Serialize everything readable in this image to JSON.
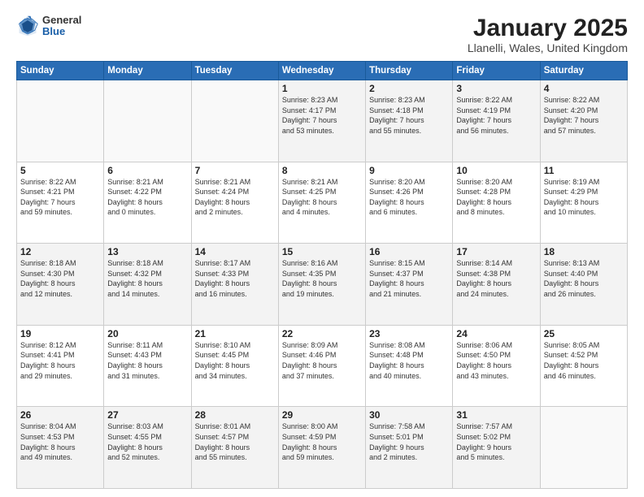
{
  "logo": {
    "general": "General",
    "blue": "Blue"
  },
  "title": {
    "month": "January 2025",
    "location": "Llanelli, Wales, United Kingdom"
  },
  "weekdays": [
    "Sunday",
    "Monday",
    "Tuesday",
    "Wednesday",
    "Thursday",
    "Friday",
    "Saturday"
  ],
  "weeks": [
    [
      {
        "day": "",
        "info": ""
      },
      {
        "day": "",
        "info": ""
      },
      {
        "day": "",
        "info": ""
      },
      {
        "day": "1",
        "info": "Sunrise: 8:23 AM\nSunset: 4:17 PM\nDaylight: 7 hours\nand 53 minutes."
      },
      {
        "day": "2",
        "info": "Sunrise: 8:23 AM\nSunset: 4:18 PM\nDaylight: 7 hours\nand 55 minutes."
      },
      {
        "day": "3",
        "info": "Sunrise: 8:22 AM\nSunset: 4:19 PM\nDaylight: 7 hours\nand 56 minutes."
      },
      {
        "day": "4",
        "info": "Sunrise: 8:22 AM\nSunset: 4:20 PM\nDaylight: 7 hours\nand 57 minutes."
      }
    ],
    [
      {
        "day": "5",
        "info": "Sunrise: 8:22 AM\nSunset: 4:21 PM\nDaylight: 7 hours\nand 59 minutes."
      },
      {
        "day": "6",
        "info": "Sunrise: 8:21 AM\nSunset: 4:22 PM\nDaylight: 8 hours\nand 0 minutes."
      },
      {
        "day": "7",
        "info": "Sunrise: 8:21 AM\nSunset: 4:24 PM\nDaylight: 8 hours\nand 2 minutes."
      },
      {
        "day": "8",
        "info": "Sunrise: 8:21 AM\nSunset: 4:25 PM\nDaylight: 8 hours\nand 4 minutes."
      },
      {
        "day": "9",
        "info": "Sunrise: 8:20 AM\nSunset: 4:26 PM\nDaylight: 8 hours\nand 6 minutes."
      },
      {
        "day": "10",
        "info": "Sunrise: 8:20 AM\nSunset: 4:28 PM\nDaylight: 8 hours\nand 8 minutes."
      },
      {
        "day": "11",
        "info": "Sunrise: 8:19 AM\nSunset: 4:29 PM\nDaylight: 8 hours\nand 10 minutes."
      }
    ],
    [
      {
        "day": "12",
        "info": "Sunrise: 8:18 AM\nSunset: 4:30 PM\nDaylight: 8 hours\nand 12 minutes."
      },
      {
        "day": "13",
        "info": "Sunrise: 8:18 AM\nSunset: 4:32 PM\nDaylight: 8 hours\nand 14 minutes."
      },
      {
        "day": "14",
        "info": "Sunrise: 8:17 AM\nSunset: 4:33 PM\nDaylight: 8 hours\nand 16 minutes."
      },
      {
        "day": "15",
        "info": "Sunrise: 8:16 AM\nSunset: 4:35 PM\nDaylight: 8 hours\nand 19 minutes."
      },
      {
        "day": "16",
        "info": "Sunrise: 8:15 AM\nSunset: 4:37 PM\nDaylight: 8 hours\nand 21 minutes."
      },
      {
        "day": "17",
        "info": "Sunrise: 8:14 AM\nSunset: 4:38 PM\nDaylight: 8 hours\nand 24 minutes."
      },
      {
        "day": "18",
        "info": "Sunrise: 8:13 AM\nSunset: 4:40 PM\nDaylight: 8 hours\nand 26 minutes."
      }
    ],
    [
      {
        "day": "19",
        "info": "Sunrise: 8:12 AM\nSunset: 4:41 PM\nDaylight: 8 hours\nand 29 minutes."
      },
      {
        "day": "20",
        "info": "Sunrise: 8:11 AM\nSunset: 4:43 PM\nDaylight: 8 hours\nand 31 minutes."
      },
      {
        "day": "21",
        "info": "Sunrise: 8:10 AM\nSunset: 4:45 PM\nDaylight: 8 hours\nand 34 minutes."
      },
      {
        "day": "22",
        "info": "Sunrise: 8:09 AM\nSunset: 4:46 PM\nDaylight: 8 hours\nand 37 minutes."
      },
      {
        "day": "23",
        "info": "Sunrise: 8:08 AM\nSunset: 4:48 PM\nDaylight: 8 hours\nand 40 minutes."
      },
      {
        "day": "24",
        "info": "Sunrise: 8:06 AM\nSunset: 4:50 PM\nDaylight: 8 hours\nand 43 minutes."
      },
      {
        "day": "25",
        "info": "Sunrise: 8:05 AM\nSunset: 4:52 PM\nDaylight: 8 hours\nand 46 minutes."
      }
    ],
    [
      {
        "day": "26",
        "info": "Sunrise: 8:04 AM\nSunset: 4:53 PM\nDaylight: 8 hours\nand 49 minutes."
      },
      {
        "day": "27",
        "info": "Sunrise: 8:03 AM\nSunset: 4:55 PM\nDaylight: 8 hours\nand 52 minutes."
      },
      {
        "day": "28",
        "info": "Sunrise: 8:01 AM\nSunset: 4:57 PM\nDaylight: 8 hours\nand 55 minutes."
      },
      {
        "day": "29",
        "info": "Sunrise: 8:00 AM\nSunset: 4:59 PM\nDaylight: 8 hours\nand 59 minutes."
      },
      {
        "day": "30",
        "info": "Sunrise: 7:58 AM\nSunset: 5:01 PM\nDaylight: 9 hours\nand 2 minutes."
      },
      {
        "day": "31",
        "info": "Sunrise: 7:57 AM\nSunset: 5:02 PM\nDaylight: 9 hours\nand 5 minutes."
      },
      {
        "day": "",
        "info": ""
      }
    ]
  ]
}
